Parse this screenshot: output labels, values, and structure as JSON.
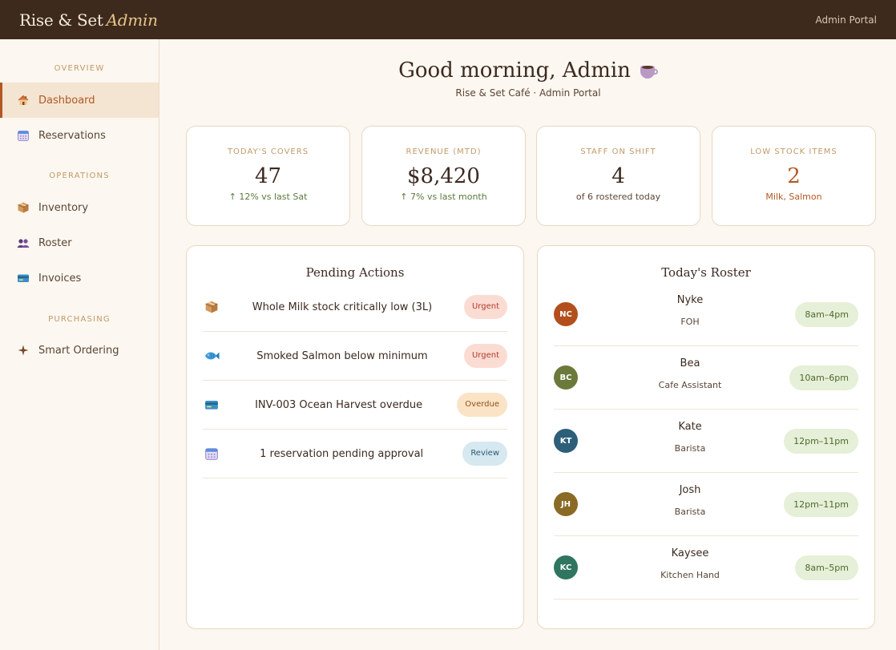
{
  "header": {
    "brand": "Rise & Set",
    "brand_accent": "Admin",
    "portal_link": "Admin Portal"
  },
  "sidebar": {
    "sections": [
      {
        "label": "OVERVIEW"
      },
      {
        "label": "OPERATIONS"
      },
      {
        "label": "PURCHASING"
      }
    ],
    "items": [
      {
        "label": "Dashboard",
        "icon": "house-icon",
        "active": true
      },
      {
        "label": "Reservations",
        "icon": "calendar-icon"
      },
      {
        "label": "Inventory",
        "icon": "package-icon"
      },
      {
        "label": "Roster",
        "icon": "people-icon"
      },
      {
        "label": "Invoices",
        "icon": "credit-card-icon"
      },
      {
        "label": "Smart Ordering",
        "icon": "sparkle-icon"
      }
    ]
  },
  "greeting": {
    "title": "Good morning, Admin",
    "subtitle": "Rise & Set Café · Admin Portal"
  },
  "stats": [
    {
      "label": "TODAY'S COVERS",
      "value": "47",
      "sub": "↑ 12% vs last Sat"
    },
    {
      "label": "REVENUE (MTD)",
      "value": "$8,420",
      "sub": "↑ 7% vs last month"
    },
    {
      "label": "STAFF ON SHIFT",
      "value": "4",
      "sub": "of 6 rostered today"
    },
    {
      "label": "LOW STOCK ITEMS",
      "value": "2",
      "sub": "Milk, Salmon"
    }
  ],
  "pending": {
    "title": "Pending Actions",
    "items": [
      {
        "icon": "package-icon",
        "text": "Whole Milk stock critically low (3L)",
        "badge": "Urgent"
      },
      {
        "icon": "fish-icon",
        "text": "Smoked Salmon below minimum",
        "badge": "Urgent"
      },
      {
        "icon": "credit-card-icon",
        "text": "INV-003 Ocean Harvest overdue",
        "badge": "Overdue"
      },
      {
        "icon": "calendar-icon",
        "text": "1 reservation pending approval",
        "badge": "Review"
      }
    ]
  },
  "roster": {
    "title": "Today's Roster",
    "staff": [
      {
        "initials": "NC",
        "name": "Nyke",
        "role": "FOH",
        "shift": "8am–4pm",
        "color": "#b24f1c"
      },
      {
        "initials": "BC",
        "name": "Bea",
        "role": "Cafe Assistant",
        "shift": "10am–6pm",
        "color": "#6b7a3a"
      },
      {
        "initials": "KT",
        "name": "Kate",
        "role": "Barista",
        "shift": "12pm–11pm",
        "color": "#2d5f7a"
      },
      {
        "initials": "JH",
        "name": "Josh",
        "role": "Barista",
        "shift": "12pm–11pm",
        "color": "#8a6a24"
      },
      {
        "initials": "KC",
        "name": "Kaysee",
        "role": "Kitchen Hand",
        "shift": "8am–5pm",
        "color": "#2f7560"
      }
    ]
  },
  "colors": {
    "accent": "#b45724",
    "topbar": "#3d2a1c",
    "positive": "#5a7a3a"
  }
}
